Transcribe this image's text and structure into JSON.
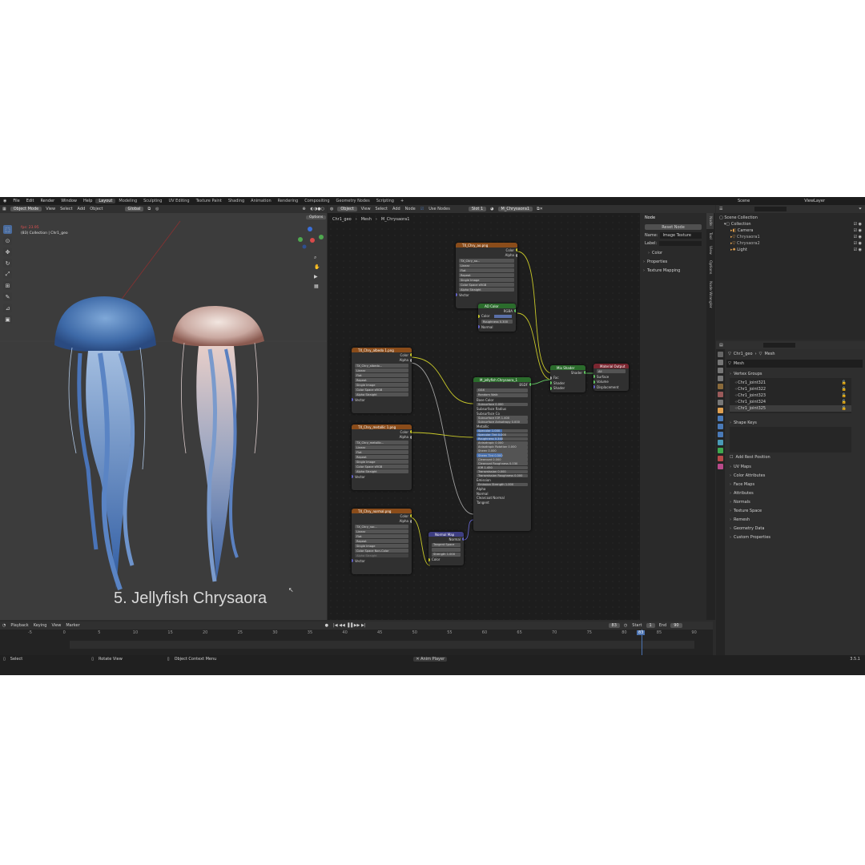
{
  "menubar": {
    "menus": [
      "File",
      "Edit",
      "Render",
      "Window",
      "Help"
    ],
    "workspaces": [
      "Layout",
      "Modeling",
      "Sculpting",
      "UV Editing",
      "Texture Paint",
      "Shading",
      "Animation",
      "Rendering",
      "Compositing",
      "Geometry Nodes",
      "Scripting"
    ],
    "active_workspace": "Layout",
    "plus": "+",
    "scene": "Scene",
    "view_layer": "ViewLayer"
  },
  "viewport": {
    "mode": "Object Mode",
    "menus": [
      "View",
      "Select",
      "Add",
      "Object"
    ],
    "transform": "Global",
    "options": "Options",
    "fps": "fps: 23.95",
    "collection_info": "(83) Collection | Chr1_geo",
    "caption": "5. Jellyfish Chrysaora",
    "tools": [
      "select-tool",
      "cursor-tool",
      "move-tool",
      "rotate-tool",
      "scale-tool",
      "transform-tool",
      "annotate-tool",
      "measure-tool",
      "add-cube-tool"
    ]
  },
  "node_editor": {
    "header": {
      "object": "Object",
      "menus": [
        "View",
        "Select",
        "Add",
        "Node"
      ],
      "use_nodes": "Use Nodes",
      "slot": "Slot 1",
      "material": "M_Chrysaora1"
    },
    "breadcrumb": [
      "Chr1_geo",
      "Mesh",
      "M_Chrysaora1"
    ],
    "nodes": {
      "tex1": {
        "title": "TX_Chry_ao.png",
        "image": "TX_Chry_ao...",
        "outputs": [
          "Color",
          "Alpha"
        ],
        "fields": [
          "Linear",
          "Flat",
          "Repeat",
          "Single Image",
          "Color Space  sRGB",
          "Alpha  Straight"
        ],
        "input": "Vector"
      },
      "rgb": {
        "title": "AO Color",
        "output": "RGBA",
        "rows": [
          "Color",
          "Roughness  0.300",
          "Normal"
        ]
      },
      "tex2": {
        "title": "TX_Chry_albedo 1.png",
        "image": "TX_Chry_albedo...",
        "outputs": [
          "Color",
          "Alpha"
        ],
        "fields": [
          "Linear",
          "Flat",
          "Repeat",
          "Single Image",
          "Color Space  sRGB",
          "Alpha  Straight"
        ],
        "input": "Vector"
      },
      "tex3": {
        "title": "TX_Chry_metallic 1.png",
        "image": "TX_Chry_metallic...",
        "outputs": [
          "Color",
          "Alpha"
        ],
        "fields": [
          "Linear",
          "Flat",
          "Repeat",
          "Single Image",
          "Color Space  sRGB",
          "Alpha  Straight"
        ],
        "input": "Vector"
      },
      "tex4": {
        "title": "TX_Chry_normal.png",
        "image": "TX_Chry_nor...",
        "outputs": [
          "Color",
          "Alpha"
        ],
        "fields": [
          "Linear",
          "Flat",
          "Repeat",
          "Single Image",
          "Color Space  Non-Color",
          "Alpha  Straight"
        ],
        "input": "Vector"
      },
      "normalmap": {
        "title": "Normal Map",
        "output": "Normal",
        "fields": [
          "Tangent Space",
          "Strength  1.000"
        ],
        "input": "Color"
      },
      "bsdf": {
        "title": "M_jellyfish Chrysaora_1",
        "output": "BSDF",
        "fields": [
          "GGX",
          "Random Walk"
        ],
        "rows": [
          "Base Color",
          "Subsurface  0.000",
          "Subsurface Radius",
          "Subsurface Co",
          "Subsurface IOR  1.400",
          "Subsurface Anisotropy  0.000",
          "Metallic",
          "Specular  1.000",
          "Specular Tint  0.000",
          "Roughness  0.340",
          "Anisotropic  0.000",
          "Anisotropic Rotation  0.000",
          "Sheen  0.000",
          "Sheen Tint  0.500",
          "Clearcoat  0.000",
          "Clearcoat Roughness  0.030",
          "IOR  1.450",
          "Transmission  0.000",
          "Transmission Roughness  0.000",
          "Emission",
          "Emission Strength  1.000",
          "Alpha",
          "Normal",
          "Clearcoat Normal",
          "Tangent"
        ]
      },
      "mix": {
        "title": "Mix Shader",
        "output": "Shader",
        "inputs": [
          "Fac",
          "Shader",
          "Shader"
        ]
      },
      "output": {
        "title": "Material Output",
        "field": "All",
        "inputs": [
          "Surface",
          "Volume",
          "Displacement"
        ]
      }
    }
  },
  "npanel": {
    "section": "Node",
    "reset": "Reset Node",
    "name_label": "Name:",
    "name_value": "Image Texture",
    "label_label": "Label:",
    "color": "Color",
    "properties": "Properties",
    "texture_mapping": "Texture Mapping",
    "tabs": [
      "Node",
      "Tool",
      "View",
      "Options",
      "Node Wrangler"
    ]
  },
  "outliner": {
    "root": "Scene Collection",
    "collection": "Collection",
    "items": [
      "Camera",
      "Chrysaora1",
      "Chrysaora2",
      "Light"
    ]
  },
  "properties": {
    "breadcrumb_object": "Chr1_geo",
    "breadcrumb_data": "Mesh",
    "mesh_name": "Mesh",
    "vertex_groups_title": "Vertex Groups",
    "vertex_groups": [
      "Chr1_joint321",
      "Chr1_joint322",
      "Chr1_joint323",
      "Chr1_joint324",
      "Chr1_joint325"
    ],
    "shape_keys_title": "Shape Keys",
    "add_rest_position": "Add Rest Position",
    "sections": [
      "UV Maps",
      "Color Attributes",
      "Face Maps",
      "Attributes",
      "Normals",
      "Texture Space",
      "Remesh",
      "Geometry Data",
      "Custom Properties"
    ]
  },
  "timeline": {
    "menus": [
      "Playback",
      "Keying",
      "View",
      "Marker"
    ],
    "current_frame": "83",
    "start_label": "Start",
    "start": "1",
    "end_label": "End",
    "end": "90",
    "ticks": [
      "-5",
      "0",
      "5",
      "10",
      "15",
      "20",
      "25",
      "30",
      "35",
      "40",
      "45",
      "50",
      "55",
      "60",
      "65",
      "70",
      "75",
      "80",
      "85",
      "90"
    ]
  },
  "statusbar": {
    "select": "Select",
    "rotate": "Rotate View",
    "context": "Object Context Menu",
    "anim": "Anim Player",
    "version": "3.5.1"
  },
  "colors": {
    "accent": "#4a72b0",
    "texture_header": "#8a4c1a",
    "shader_header": "#2b6c2c",
    "vector_header": "#3e3e82",
    "output_header": "#7a2630",
    "socket_yellow": "#c7c729"
  }
}
